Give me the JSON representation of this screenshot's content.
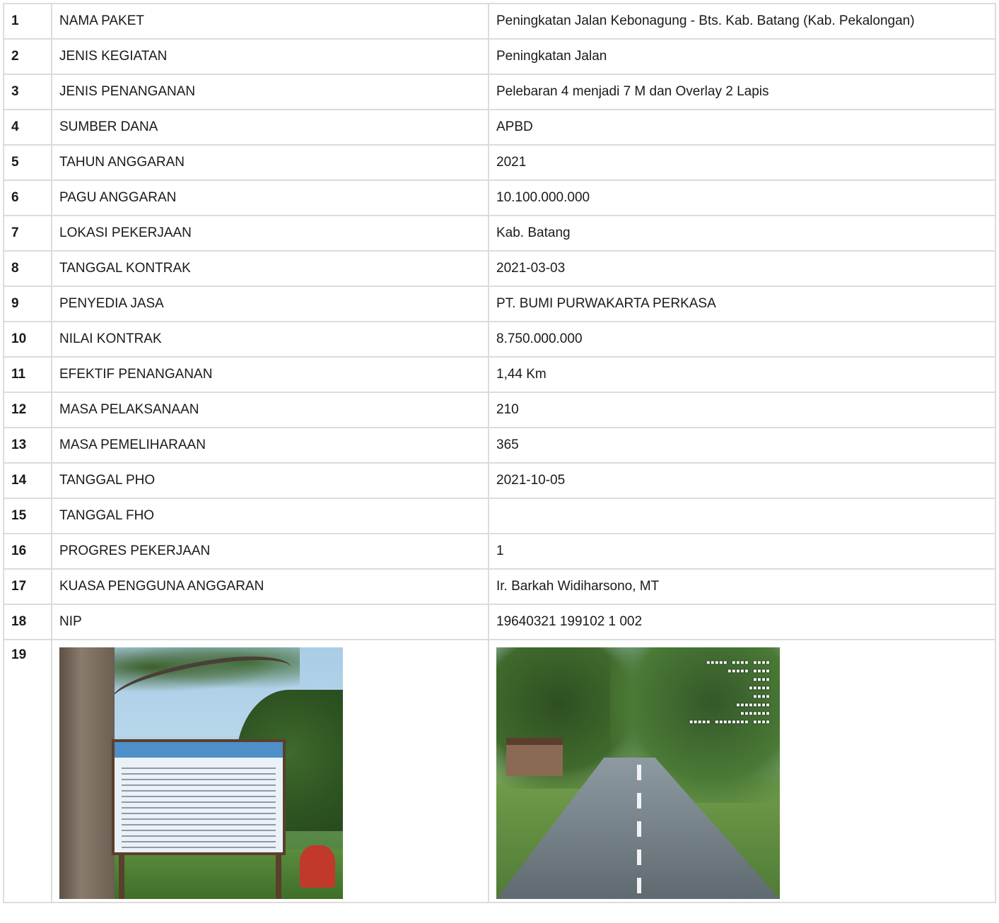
{
  "rows": [
    {
      "num": "1",
      "label": "NAMA PAKET",
      "value": "Peningkatan Jalan Kebonagung - Bts. Kab. Batang (Kab. Pekalongan)"
    },
    {
      "num": "2",
      "label": "JENIS KEGIATAN",
      "value": "Peningkatan Jalan"
    },
    {
      "num": "3",
      "label": "JENIS PENANGANAN",
      "value": "Pelebaran 4 menjadi 7 M dan Overlay 2 Lapis"
    },
    {
      "num": "4",
      "label": "SUMBER DANA",
      "value": "APBD"
    },
    {
      "num": "5",
      "label": "TAHUN ANGGARAN",
      "value": "2021"
    },
    {
      "num": "6",
      "label": "PAGU ANGGARAN",
      "value": "10.100.000.000"
    },
    {
      "num": "7",
      "label": "LOKASI PEKERJAAN",
      "value": "Kab. Batang"
    },
    {
      "num": "8",
      "label": "TANGGAL KONTRAK",
      "value": "2021-03-03"
    },
    {
      "num": "9",
      "label": "PENYEDIA JASA",
      "value": "PT. BUMI PURWAKARTA PERKASA"
    },
    {
      "num": "10",
      "label": "NILAI KONTRAK",
      "value": "8.750.000.000"
    },
    {
      "num": "11",
      "label": "EFEKTIF PENANGANAN",
      "value": "1,44 Km"
    },
    {
      "num": "12",
      "label": "MASA PELAKSANAAN",
      "value": "210"
    },
    {
      "num": "13",
      "label": "MASA PEMELIHARAAN",
      "value": "365"
    },
    {
      "num": "14",
      "label": "TANGGAL PHO",
      "value": "2021-10-05"
    },
    {
      "num": "15",
      "label": "TANGGAL FHO",
      "value": ""
    },
    {
      "num": "16",
      "label": "PROGRES PEKERJAAN",
      "value": "1"
    },
    {
      "num": "17",
      "label": "KUASA PENGGUNA ANGGARAN",
      "value": "Ir. Barkah Widiharsono, MT"
    },
    {
      "num": "18",
      "label": "NIP",
      "value": "19640321 199102 1 002"
    }
  ],
  "photo_row": {
    "num": "19"
  }
}
